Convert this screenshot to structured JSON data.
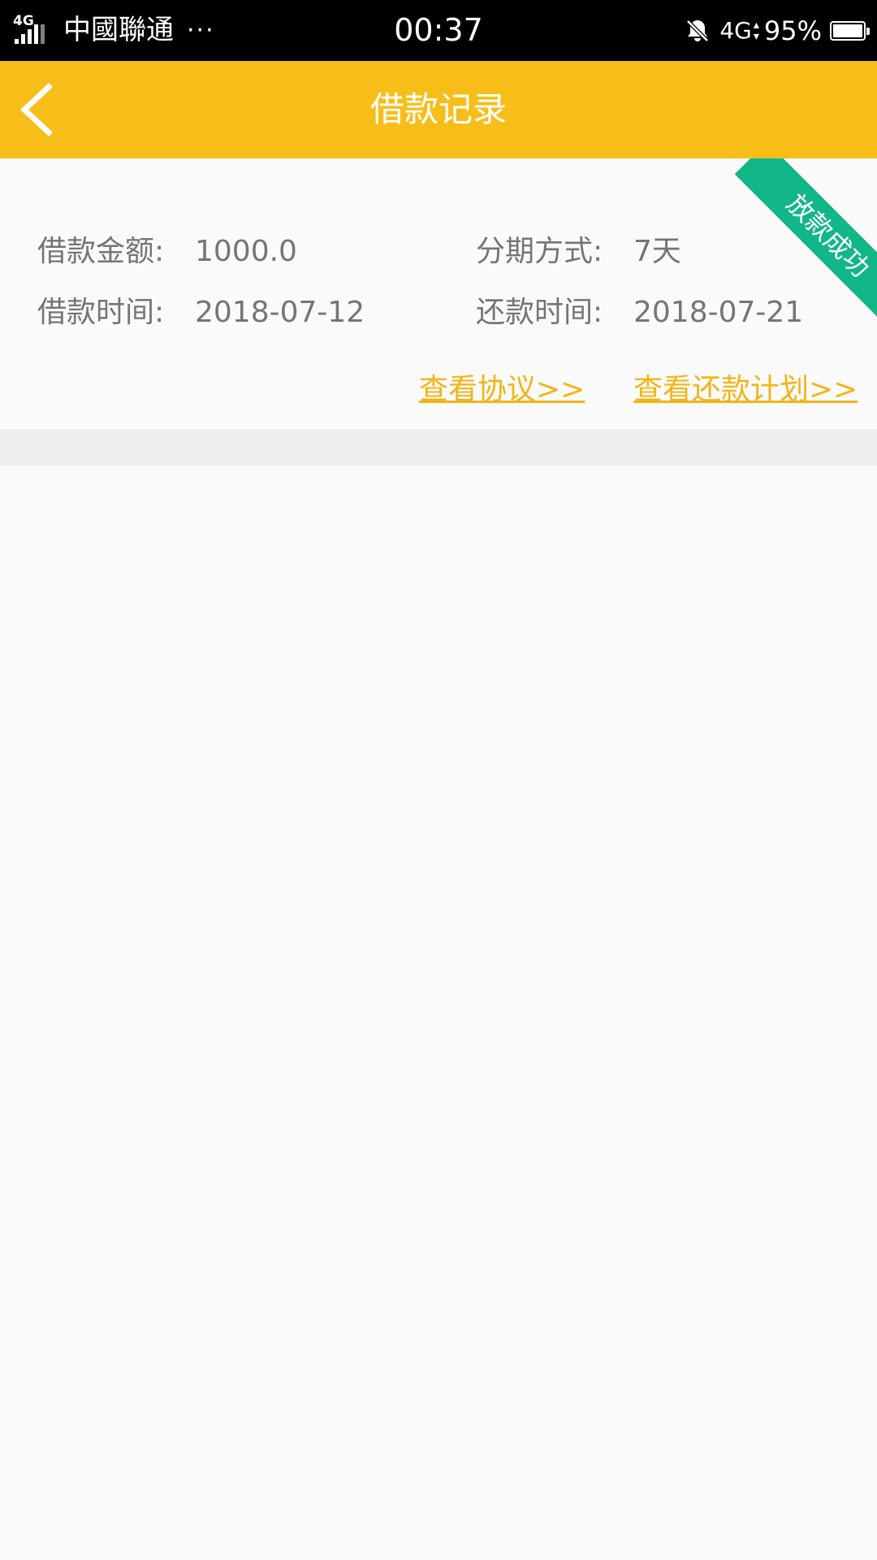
{
  "status_bar": {
    "network_small": "4G",
    "carrier": "中國聯通",
    "more": "···",
    "time": "00:37",
    "network": "4G",
    "battery": "95%"
  },
  "header": {
    "title": "借款记录",
    "back_icon": "chevron-left-icon",
    "background_color": "#f7be1a"
  },
  "loan_record": {
    "status_ribbon": "放款成功",
    "status_color": "#12b687",
    "fields": [
      {
        "label": "借款金额:",
        "value": "1000.0"
      },
      {
        "label": "分期方式:",
        "value": "7天"
      },
      {
        "label": "借款时间:",
        "value": "2018-07-12"
      },
      {
        "label": "还款时间:",
        "value": "2018-07-21"
      }
    ],
    "links": {
      "view_agreement": "查看协议>>",
      "view_repayment_plan": "查看还款计划>>"
    },
    "link_color": "#f2b516"
  }
}
